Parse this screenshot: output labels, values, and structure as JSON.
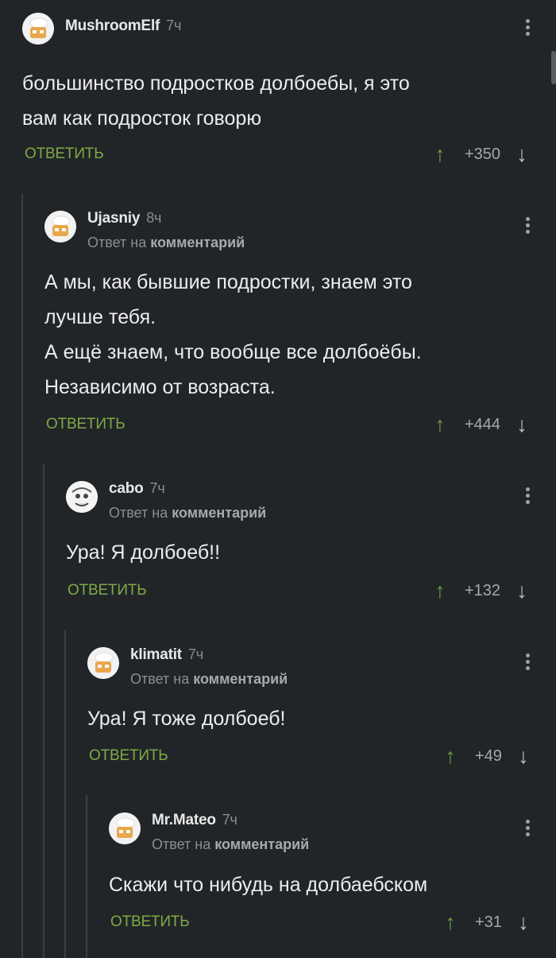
{
  "labels": {
    "reply": "ОТВЕТИТЬ",
    "reply_to_prefix": "Ответ на",
    "reply_to_link": "комментарий"
  },
  "comments": [
    {
      "user": "MushroomElf",
      "time": "7ч",
      "text": "большинство подростков долбоебы, я это\nвам как подросток говорю",
      "score": "+350"
    },
    {
      "user": "Ujasniy",
      "time": "8ч",
      "text": "А мы, как бывшие подростки, знаем это\nлучше тебя.\nА ещё знаем, что вообще все долбоёбы.\nНезависимо от возраста.",
      "score": "+444"
    },
    {
      "user": "cabo",
      "time": "7ч",
      "text": "Ура! Я долбоеб!!",
      "score": "+132"
    },
    {
      "user": "klimatit",
      "time": "7ч",
      "text": "Ура! Я тоже долбоеб!",
      "score": "+49"
    },
    {
      "user": "Mr.Mateo",
      "time": "7ч",
      "text": "Скажи что нибудь на долбаебском",
      "score": "+31"
    }
  ],
  "icons": {
    "up": "arrow-up-icon",
    "down": "arrow-down-icon",
    "more": "more-vertical-icon"
  },
  "colors": {
    "background": "#222528",
    "accent": "#7daa46",
    "muted": "#8a8d91"
  }
}
